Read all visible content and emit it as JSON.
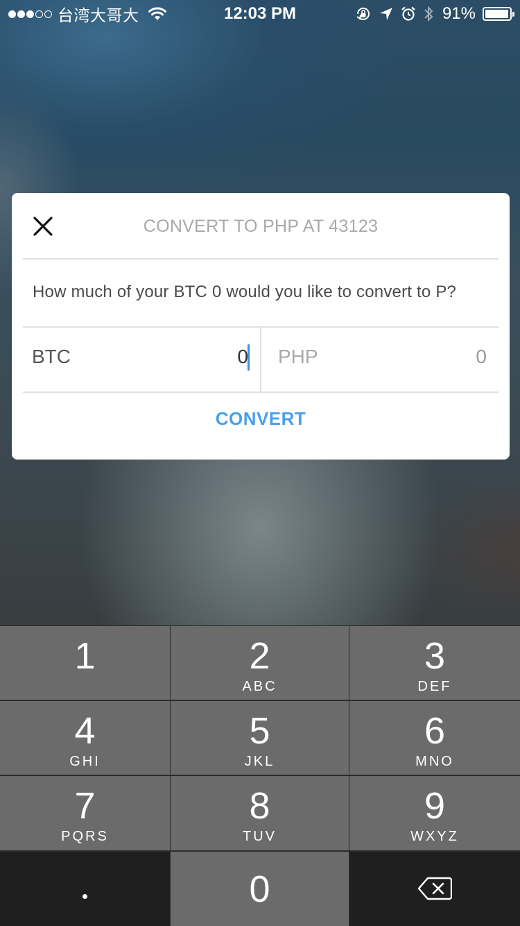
{
  "status_bar": {
    "signal_dots_full": 3,
    "signal_dots_total": 5,
    "carrier": "台湾大哥大",
    "time": "12:03 PM",
    "battery_percent": "91%",
    "battery_level": 0.91,
    "icons": [
      "wifi-icon",
      "orientation-lock-icon",
      "location-arrow-icon",
      "alarm-icon",
      "bluetooth-icon",
      "battery-icon"
    ]
  },
  "dialog": {
    "title": "CONVERT TO PHP AT 43123",
    "message": "How much of your BTC 0 would you like to convert to P?",
    "btc_field": {
      "label": "BTC",
      "value": "0"
    },
    "php_field": {
      "label": "PHP",
      "value": "0"
    },
    "convert_label": "CONVERT",
    "accent_color": "#4aa0ea"
  },
  "keypad": {
    "keys": [
      {
        "digit": "1",
        "letters": ""
      },
      {
        "digit": "2",
        "letters": "ABC"
      },
      {
        "digit": "3",
        "letters": "DEF"
      },
      {
        "digit": "4",
        "letters": "GHI"
      },
      {
        "digit": "5",
        "letters": "JKL"
      },
      {
        "digit": "6",
        "letters": "MNO"
      },
      {
        "digit": "7",
        "letters": "PQRS"
      },
      {
        "digit": "8",
        "letters": "TUV"
      },
      {
        "digit": "9",
        "letters": "WXYZ"
      }
    ],
    "zero": "0",
    "decimal_icon": "decimal-point",
    "backspace_icon": "backspace-icon"
  }
}
